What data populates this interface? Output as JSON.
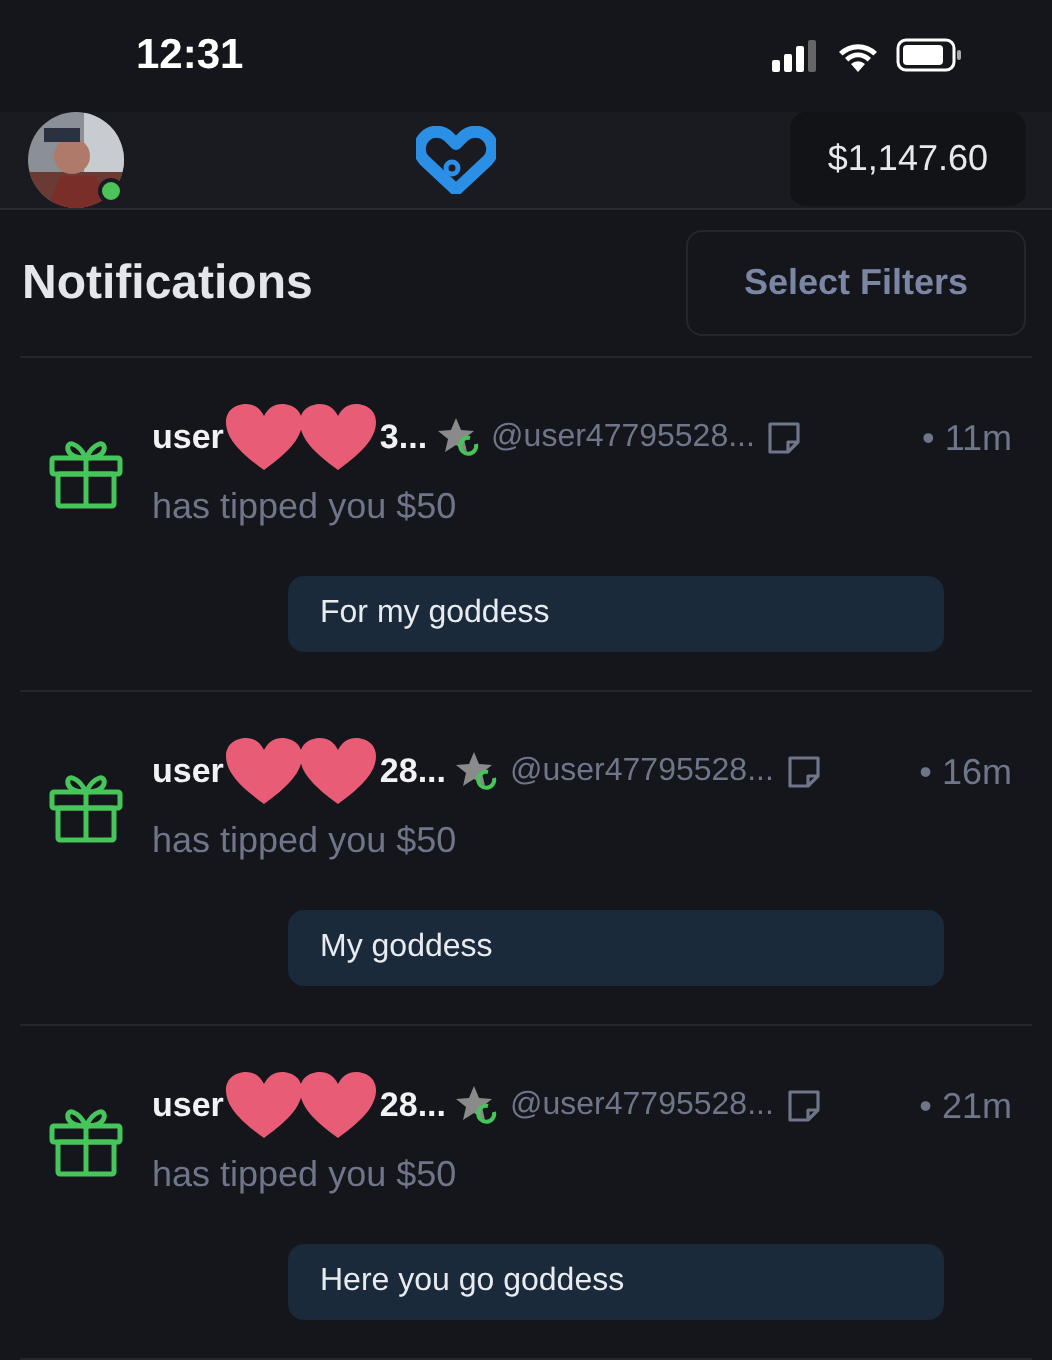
{
  "status_bar": {
    "time": "12:31"
  },
  "header": {
    "avatar": {
      "kind": "picture",
      "online": true
    },
    "balance": "$1,147.60"
  },
  "title": "Notifications",
  "filter_button": "Select Filters",
  "notifications": [
    {
      "name_start": "user",
      "name_end": "3...",
      "handle": "@user47795528...",
      "time": "• 11m",
      "text": "has tipped you $50",
      "message": "For my goddess"
    },
    {
      "name_start": "user",
      "name_end": "28...",
      "handle": "@user47795528...",
      "time": "• 16m",
      "text": "has tipped you $50",
      "message": "My goddess"
    },
    {
      "name_start": "user",
      "name_end": "28...",
      "handle": "@user47795528...",
      "time": "• 21m",
      "text": "has tipped you $50",
      "message": "Here you go goddess"
    }
  ]
}
